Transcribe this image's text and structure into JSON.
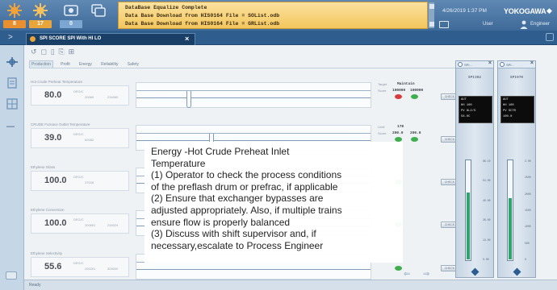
{
  "alarms": [
    {
      "name": "critical",
      "count": "8",
      "color": "#e8902f"
    },
    {
      "name": "high",
      "count": "17",
      "color": "#e8a53b"
    },
    {
      "name": "medium",
      "count": "0",
      "color": "#7ca6d2"
    },
    {
      "name": "low",
      "count": "",
      "color": "#7ca6d2"
    }
  ],
  "banner": {
    "line1": "DataBase Equalize Complete",
    "line2": "Data Base Download from HIS0164 File = SOList.odb",
    "line3": "Data Base Download from HIS0164 File = GRList.odb"
  },
  "header": {
    "datetime": "4/26/2019 1:37 PM",
    "brand": "YOKOGAWA",
    "brand_mark": "◆",
    "user_label": "User",
    "user_name": "Engineer"
  },
  "window": {
    "back_glyph": ">",
    "tab_title": "SPI SCORE SPI With HI LO",
    "close_glyph": "×"
  },
  "toolbar": {
    "icons": "↺ ◻ ▯ ⎘ ⊞",
    "tabs": [
      "Production",
      "Profit",
      "Energy",
      "Reliability",
      "Safety"
    ],
    "active_tab": 0
  },
  "rows": [
    {
      "label": "Hot Crude Preheat Temperature",
      "value": "80.0",
      "unit": "DEG/C",
      "tag": "20060",
      "tag2": "234060",
      "meta": {
        "l1": "Target",
        "v1": "Maintain",
        "l2": "Score",
        "v2": "100000",
        "v3": "100000",
        "dot1": "#d83b3b",
        "dot2": "#3fae4c"
      },
      "button": "CHECK"
    },
    {
      "label": "CRUDE Furnace Outlet Temperature",
      "value": "39.0",
      "unit": "DEG/C",
      "tag": "60082",
      "tag2": "",
      "meta": {
        "l1": "Limit",
        "v1": "178",
        "l2": "Score",
        "v2": "200.0",
        "v3": "200.0",
        "dot1": "#3fae4c",
        "dot2": "#3fae4c"
      },
      "button": "CHECK"
    },
    {
      "label": "Ethylene Glass",
      "value": "100.0",
      "unit": "DEG/C",
      "tag": "37028",
      "tag2": "",
      "meta": {
        "l1": "",
        "v1": "",
        "l2": "",
        "v2": "",
        "v3": "",
        "dot1": "#3fae4c",
        "dot2": ""
      },
      "button": "CHECK"
    },
    {
      "label": "Ethylene Conversion",
      "value": "100.0",
      "unit": "DEG/C",
      "tag": "200601",
      "tag2": "234024",
      "meta": {
        "l1": "",
        "v1": "",
        "l2": "",
        "v2": "",
        "v3": "",
        "dot1": "#3fae4c",
        "dot2": ""
      },
      "button": "CHECK"
    },
    {
      "label": "Ethylene Selectivity",
      "value": "55.6",
      "unit": "DEG/C",
      "tag": "200201",
      "tag2": "304000",
      "meta": {
        "l1": "",
        "v1": "",
        "l2": "",
        "v2": "",
        "v3": "",
        "dot1": "#3fae4c",
        "dot2": ""
      },
      "button": "CHECK"
    }
  ],
  "faceplates": [
    {
      "title": "SPI...",
      "tag": "SPI302",
      "lines": [
        "AUT",
        "HH 100",
        "PV  8L2/S",
        "    58.0C"
      ],
      "fill": 0.68,
      "ticks": [
        "66.10",
        "53.00",
        "40.00",
        "26.00",
        "13.00",
        "0.00"
      ]
    },
    {
      "title": "SPI...",
      "tag": "SPI070",
      "lines": [
        "AUT",
        "HH 100",
        "PV  SCTR",
        "    100.0"
      ],
      "fill": 0.62,
      "ticks": [
        "2.00",
        "2500",
        "2000",
        "1500",
        "1000",
        "500",
        "0"
      ]
    }
  ],
  "note": {
    "lines": [
      "Energy -Hot Crude Preheat Inlet",
      "Temperature",
      "(1) Operator to check the process conditions",
      "of the preflash drum or prefrac, if applicable",
      "(2) Ensure that exchanger bypasses are",
      "adjusted appropriately. Also, if multiple trains",
      "ensure flow is properly balanced",
      "(3) Discuss with shift supervisor and, if",
      "necessary,escalate to Process Engineer"
    ]
  },
  "nav": {
    "arrows": "⇐ ⇒"
  },
  "status": {
    "text": "Ready"
  }
}
